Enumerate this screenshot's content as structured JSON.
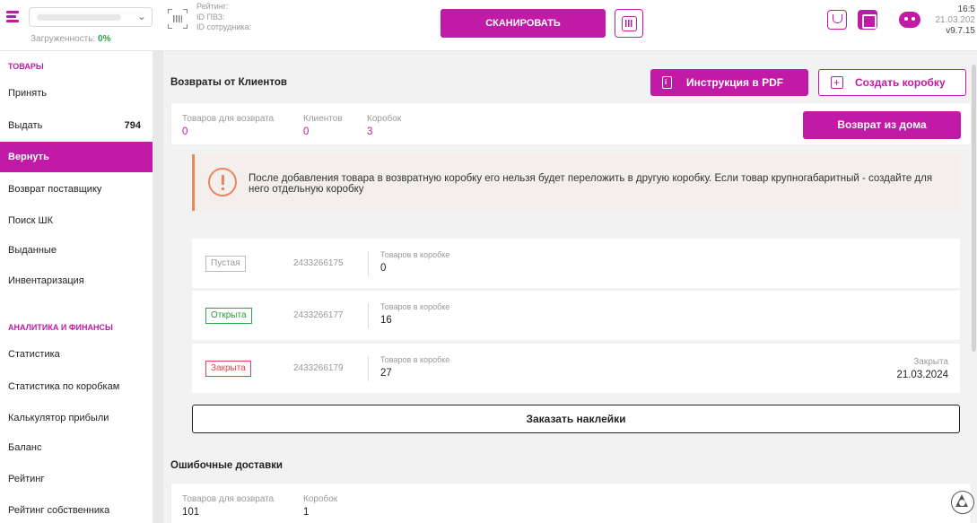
{
  "header": {
    "load_label": "Загруженность:",
    "load_value": "0%",
    "rating_label": "Рейтинг:",
    "pvz_id_label": "ID ПВЗ:",
    "employee_id_label": "ID сотрудника:",
    "scan_label": "СКАНИРОВАТЬ",
    "time": "16:5",
    "date": "21.03.202",
    "version": "v9.7.15",
    "icons": [
      "menu-icon",
      "chevron-down-icon",
      "barcode-icon",
      "scan-icon",
      "glass-icon",
      "box-icon",
      "chat-bot-icon"
    ]
  },
  "sidebar": {
    "section_goods": "ТОВАРЫ",
    "section_analytics": "АНАЛИТИКА И ФИНАНСЫ",
    "items": [
      {
        "label": "Принять"
      },
      {
        "label": "Выдать",
        "count": "794"
      },
      {
        "label": "Вернуть",
        "active": true
      },
      {
        "label": "Возврат поставщику"
      },
      {
        "label": "Поиск ШК"
      },
      {
        "label": "Выданные"
      },
      {
        "label": "Инвентаризация"
      },
      {
        "label": "Статистика"
      },
      {
        "label": "Статистика по коробкам"
      },
      {
        "label": "Калькулятор прибыли"
      },
      {
        "label": "Баланс"
      },
      {
        "label": "Рейтинг"
      },
      {
        "label": "Рейтинг собственника"
      }
    ]
  },
  "returns": {
    "title": "Возвраты от Клиентов",
    "pdf_button": "Инструкция в PDF",
    "create_box_button": "Создать коробку",
    "stats": {
      "goods_label": "Товаров для возврата",
      "goods_value": "0",
      "clients_label": "Клиентов",
      "clients_value": "0",
      "boxes_label": "Коробок",
      "boxes_value": "3"
    },
    "home_return_button": "Возврат из дома",
    "notice": "После добавления товара в возвратную коробку его нельзя будет переложить в другую коробку. Если товар крупногабаритный - создайте для него отдельную коробку",
    "boxes": [
      {
        "status": "Пустая",
        "id": "2433266175",
        "count_label": "Товаров в коробке",
        "count": "0"
      },
      {
        "status": "Открыта",
        "id": "2433266177",
        "count_label": "Товаров в коробке",
        "count": "16"
      },
      {
        "status": "Закрыта",
        "id": "2433266179",
        "count_label": "Товаров в коробке",
        "count": "27",
        "closed_label": "Закрыта",
        "closed_date": "21.03.2024"
      }
    ],
    "stickers_button": "Заказать наклейки"
  },
  "errors": {
    "title": "Ошибочные доставки",
    "goods_label": "Товаров для возврата",
    "goods_value": "101",
    "boxes_label": "Коробок",
    "boxes_value": "1"
  },
  "colors": {
    "accent": "#c01aa7",
    "success": "#2aa44a",
    "danger": "#e0444a",
    "warning": "#e8885f"
  }
}
